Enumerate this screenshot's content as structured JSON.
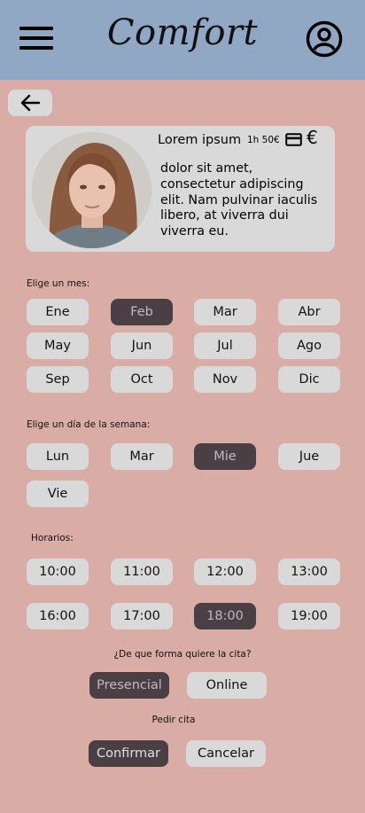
{
  "header": {
    "logo": "Comfort"
  },
  "card": {
    "name": "Lorem ipsum",
    "price": "1h 50€",
    "currency_symbol": "€",
    "description": "dolor sit amet, consectetur adipiscing elit. Nam pulvinar iaculis libero, at viverra dui viverra eu."
  },
  "months": {
    "label": "Elige un mes:",
    "items": [
      "Ene",
      "Feb",
      "Mar",
      "Abr",
      "May",
      "Jun",
      "Jul",
      "Ago",
      "Sep",
      "Oct",
      "Nov",
      "Dic"
    ],
    "selected": "Feb"
  },
  "days": {
    "label": "Elige un día de la semana:",
    "items": [
      "Lun",
      "Mar",
      "Mie",
      "Jue",
      "Vie"
    ],
    "selected": "Mie"
  },
  "hours": {
    "label": "Horarios:",
    "items": [
      "10:00",
      "11:00",
      "12:00",
      "13:00",
      "16:00",
      "17:00",
      "18:00",
      "19:00"
    ],
    "selected": "18:00"
  },
  "mode": {
    "question": "¿De que forma quiere la cita?",
    "options": [
      "Presencial",
      "Online"
    ],
    "selected": "Presencial"
  },
  "actions": {
    "label": "Pedir cita",
    "confirm": "Confirmar",
    "cancel": "Cancelar"
  },
  "colors": {
    "background": "#d9aca5",
    "header": "#91a8c5",
    "chip": "#d9d9d9",
    "chip_selected": "#4b3f46"
  }
}
